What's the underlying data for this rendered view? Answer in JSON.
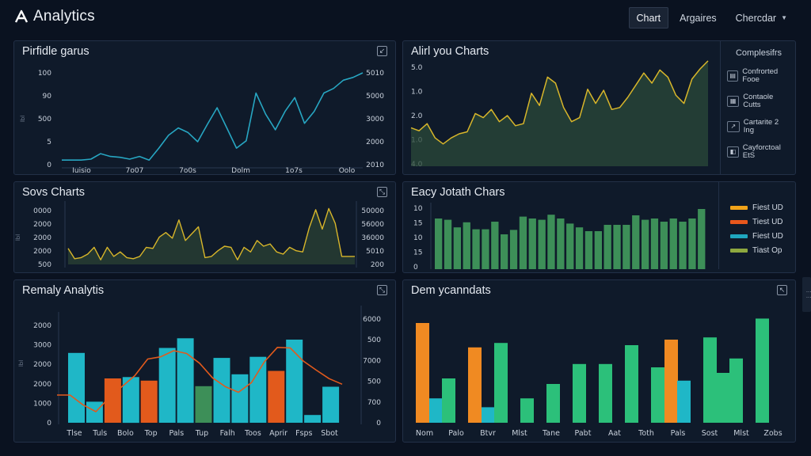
{
  "app": {
    "title": "Analytics"
  },
  "tabs": [
    {
      "label": "Chart",
      "active": true
    },
    {
      "label": "Argaires",
      "active": false
    },
    {
      "label": "Chercdar",
      "active": false,
      "dropdown": true
    }
  ],
  "colors": {
    "blue": "#27a6c2",
    "yellow": "#d8b62a",
    "orange": "#f08a22",
    "redorange": "#e25a1c",
    "teal": "#1fb7c7",
    "green": "#2cc07a",
    "bargreen": "#3d8f58",
    "olive": "#8ea83f"
  },
  "panels": {
    "p1": {
      "title": "Pirfidle garus",
      "icon": "export-icon",
      "chart_data": {
        "type": "line",
        "categories": [
          "Iuisio",
          "7o07",
          "7o0s",
          "Dolm",
          "1o7s",
          "Oolo"
        ],
        "left_ticks": [
          "100",
          "90",
          "500",
          "5",
          "0"
        ],
        "right_ticks": [
          "5010",
          "5000",
          "3000",
          "2000",
          "2010"
        ],
        "side_label": "lbl",
        "ylim": [
          0,
          100
        ],
        "series": [
          {
            "values": [
              5,
              5,
              5,
              6,
              12,
              9,
              8,
              6,
              9,
              5,
              18,
              32,
              40,
              35,
              25,
              44,
              62,
              40,
              18,
              26,
              78,
              55,
              38,
              58,
              73,
              45,
              58,
              78,
              83,
              92,
              95,
              100
            ]
          }
        ]
      }
    },
    "p2": {
      "title": "Alirl you Charts",
      "icon": "collapse-icon",
      "chart_data": {
        "type": "area",
        "left_ticks": [
          "5.0",
          "1.0",
          "2.0",
          "1.0",
          "4.0"
        ],
        "ylim": [
          0,
          100
        ],
        "series": [
          {
            "values": [
              38,
              35,
              42,
              28,
              22,
              28,
              32,
              34,
              52,
              48,
              56,
              44,
              50,
              40,
              42,
              72,
              60,
              88,
              82,
              58,
              44,
              48,
              76,
              62,
              75,
              56,
              58,
              68,
              80,
              92,
              82,
              95,
              88,
              70,
              62,
              86,
              96,
              104
            ]
          }
        ]
      },
      "legend": {
        "title": "Complesifrs",
        "items": [
          {
            "icon": "chart-icon",
            "label": "Confrorted Fooe"
          },
          {
            "icon": "chart-icon",
            "label": "Contaole Cutts"
          },
          {
            "icon": "chart-icon",
            "label": "Cartarite 2 Ing"
          },
          {
            "icon": "chart-icon",
            "label": "Cayforctoal EtS"
          }
        ]
      }
    },
    "p3": {
      "title": "Sovs Charts",
      "icon": "expand-icon",
      "chart_data": {
        "type": "area",
        "left_ticks": [
          "0000",
          "2000",
          "2000",
          "2000",
          "500"
        ],
        "right_ticks": [
          "50000",
          "56000",
          "36000",
          "5010",
          "200"
        ],
        "side_label": "lbl",
        "ylim": [
          0,
          100
        ],
        "series": [
          {
            "values": [
              28,
              10,
              12,
              18,
              30,
              8,
              30,
              14,
              22,
              12,
              10,
              14,
              30,
              28,
              48,
              56,
              46,
              78,
              42,
              54,
              66,
              12,
              14,
              24,
              32,
              30,
              8,
              30,
              22,
              42,
              32,
              36,
              22,
              18,
              30,
              24,
              22,
              64,
              96,
              62,
              98,
              72,
              14,
              14,
              14
            ]
          }
        ]
      }
    },
    "p4": {
      "title": "Eacy Jotath Chars",
      "chart_data": {
        "type": "bar",
        "left_ticks": [
          "10",
          "15",
          "10",
          "15",
          "0"
        ],
        "ylim": [
          0,
          100
        ],
        "values": [
          80,
          78,
          66,
          74,
          63,
          63,
          75,
          55,
          62,
          83,
          80,
          78,
          86,
          80,
          72,
          66,
          60,
          60,
          70,
          70,
          70,
          85,
          78,
          80,
          75,
          80,
          75,
          80,
          95
        ]
      },
      "legend": {
        "items": [
          {
            "color": "#f1a319",
            "label": "Fiest UD"
          },
          {
            "color": "#e8571c",
            "label": "Tiest UD"
          },
          {
            "color": "#1fa7c0",
            "label": "Fiest UD"
          },
          {
            "color": "#8ea83f",
            "label": "Tiast Op"
          }
        ]
      }
    },
    "p5": {
      "title": "Remaly Analytis",
      "icon": "expand-icon",
      "chart_data": {
        "type": "bar",
        "categories": [
          "Tlse",
          "Tuls",
          "Bolo",
          "Top",
          "Pals",
          "Tup",
          "Falh",
          "Toos",
          "Aprir",
          "Fsps",
          "Sbot"
        ],
        "left_ticks": [
          "2000",
          "3000",
          "2000",
          "2000",
          "1000",
          "0"
        ],
        "right_ticks": [
          "6000",
          "500",
          "7000",
          "500",
          "700",
          "0"
        ],
        "side_label": "lbl",
        "ylim": [
          0,
          4000
        ],
        "values": [
          2520,
          760,
          1600,
          1650,
          1520,
          2700,
          3050,
          1320,
          2340,
          1750,
          2380,
          1870,
          3000,
          280,
          1300
        ],
        "line": [
          1000,
          1000,
          650,
          400,
          900,
          1300,
          1700,
          2300,
          2380,
          2600,
          2500,
          2150,
          1620,
          1300,
          1100,
          1450,
          2200,
          2720,
          2700,
          2230,
          1900,
          1590,
          1390
        ]
      }
    },
    "p6": {
      "title": "Dem ycanndats",
      "icon": "collapse-icon",
      "chart_data": {
        "type": "bar",
        "categories": [
          "Nom",
          "Palo",
          "Btvr",
          "Mlst",
          "Tane",
          "Pabt",
          "Aat",
          "Toth",
          "Pals",
          "Sost",
          "Mlst",
          "Zobs"
        ],
        "ylim": [
          0,
          100
        ],
        "values": [
          90,
          22,
          40,
          68,
          14,
          72,
          22,
          35,
          53,
          53,
          70,
          50,
          75,
          38,
          77,
          45,
          58,
          94
        ]
      }
    }
  }
}
